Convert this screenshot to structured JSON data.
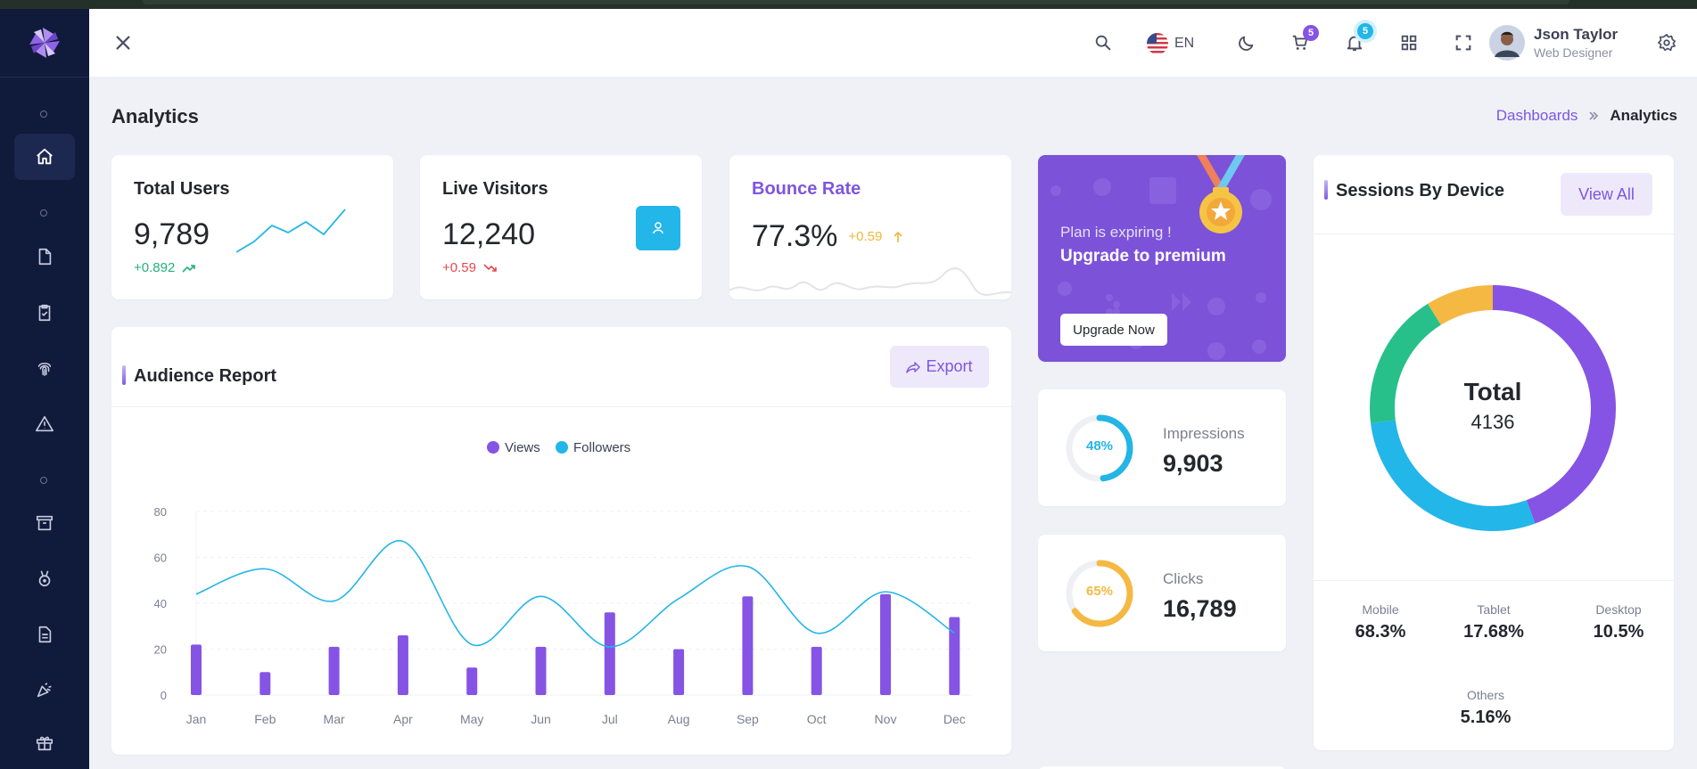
{
  "header": {
    "language": "EN",
    "cart_count": "5",
    "notif_count": "5",
    "user_name": "Json Taylor",
    "user_role": "Web Designer"
  },
  "page": {
    "title": "Analytics",
    "breadcrumb_parent": "Dashboards",
    "breadcrumb_current": "Analytics"
  },
  "stats": {
    "total_users": {
      "label": "Total Users",
      "value": "9,789",
      "change": "+0.892"
    },
    "live_visitors": {
      "label": "Live Visitors",
      "value": "12,240",
      "change": "+0.59"
    },
    "bounce_rate": {
      "label": "Bounce Rate",
      "value": "77.3%",
      "change": "+0.59"
    }
  },
  "promo": {
    "line1": "Plan is expiring !",
    "line2": "Upgrade to premium",
    "button": "Upgrade Now"
  },
  "impressions": {
    "percent": "48%",
    "label": "Impressions",
    "value": "9,903",
    "fraction": 0.48,
    "color": "#22b5e5"
  },
  "clicks": {
    "percent": "65%",
    "label": "Clicks",
    "value": "16,789",
    "fraction": 0.65,
    "color": "#f5b842"
  },
  "audience": {
    "title": "Audience Report",
    "export_label": "Export"
  },
  "sessions": {
    "title": "Sessions By Device",
    "view_all": "View All",
    "total_label": "Total",
    "total_value": "4136",
    "devices": [
      {
        "name": "Mobile",
        "value": "68.3%"
      },
      {
        "name": "Tablet",
        "value": "17.68%"
      },
      {
        "name": "Desktop",
        "value": "10.5%"
      },
      {
        "name": "Others",
        "value": "5.16%"
      }
    ],
    "donut": [
      {
        "label": "Mobile",
        "share": 0.444,
        "color": "#8554e4"
      },
      {
        "label": "Tablet",
        "share": 0.286,
        "color": "#23b6e8"
      },
      {
        "label": "Desktop",
        "share": 0.181,
        "color": "#27c08b"
      },
      {
        "label": "Others",
        "share": 0.089,
        "color": "#f5b842"
      }
    ]
  },
  "chart_data": {
    "type": "bar+line",
    "categories": [
      "Jan",
      "Feb",
      "Mar",
      "Apr",
      "May",
      "Jun",
      "Jul",
      "Aug",
      "Sep",
      "Oct",
      "Nov",
      "Dec"
    ],
    "ylim": [
      0,
      80
    ],
    "yticks": [
      0,
      20,
      40,
      60,
      80
    ],
    "series": [
      {
        "name": "Views",
        "type": "bar",
        "color": "#8554e4",
        "values": [
          22,
          10,
          21,
          26,
          12,
          21,
          36,
          20,
          43,
          21,
          44,
          34
        ]
      },
      {
        "name": "Followers",
        "type": "line",
        "color": "#23b6e8",
        "values": [
          44,
          55,
          41,
          67,
          22,
          43,
          21,
          42,
          56,
          27,
          45,
          27
        ]
      }
    ]
  }
}
